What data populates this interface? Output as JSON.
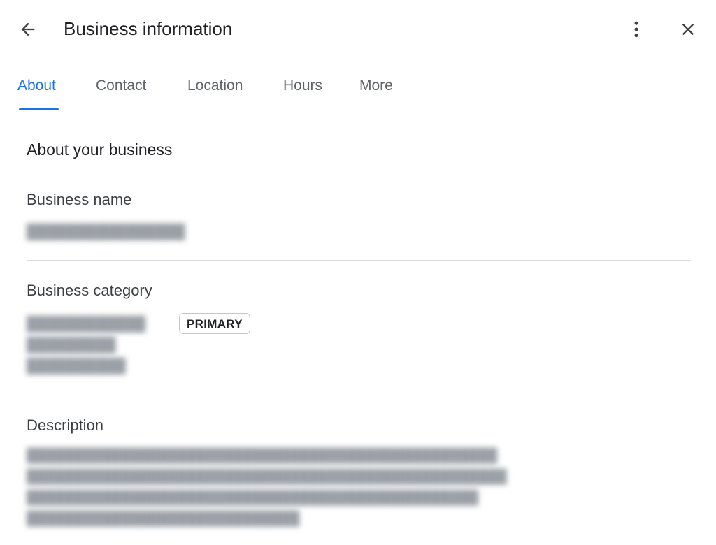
{
  "header": {
    "title": "Business information",
    "back_icon": "arrow-back-icon",
    "more_icon": "more-vert-icon",
    "close_icon": "close-icon"
  },
  "tabs": [
    {
      "label": "About",
      "active": true
    },
    {
      "label": "Contact",
      "active": false
    },
    {
      "label": "Location",
      "active": false
    },
    {
      "label": "Hours",
      "active": false
    },
    {
      "label": "More",
      "active": false
    }
  ],
  "section": {
    "heading": "About your business"
  },
  "business_name": {
    "label": "Business name"
  },
  "business_category": {
    "label": "Business category",
    "primary_badge": "PRIMARY"
  },
  "description": {
    "label": "Description"
  },
  "colors": {
    "accent": "#1a73e8",
    "text_primary": "#202124",
    "text_secondary": "#5f6368",
    "divider": "#dadce0"
  }
}
